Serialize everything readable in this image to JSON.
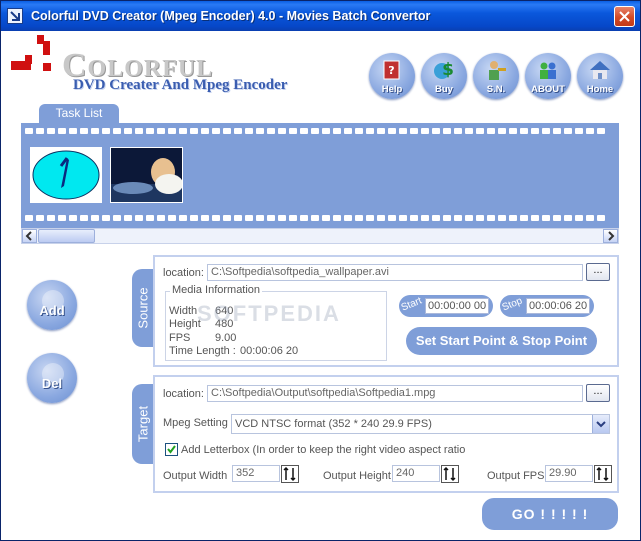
{
  "window": {
    "title": "Colorful DVD Creator (Mpeg Encoder) 4.0 - Movies Batch Convertor"
  },
  "logo": {
    "brand": "Colorful",
    "tagline": "DVD Creater And Mpeg Encoder"
  },
  "toolbar": [
    {
      "label": "Help",
      "icon": "help-book-icon"
    },
    {
      "label": "Buy",
      "icon": "dollar-globe-icon"
    },
    {
      "label": "S.N.",
      "icon": "person-key-icon"
    },
    {
      "label": "ABOUT",
      "icon": "people-icon"
    },
    {
      "label": "Home",
      "icon": "house-icon"
    }
  ],
  "tasklist": {
    "tab_label": "Task List"
  },
  "side": {
    "add_label": "Add",
    "del_label": "Del"
  },
  "source": {
    "tab_label": "Source",
    "location_label": "location:",
    "location_value": "C:\\Softpedia\\softpedia_wallpaper.avi",
    "browse_label": "...",
    "media_info": {
      "legend": "Media Information",
      "width_label": "Width",
      "width_value": "640",
      "height_label": "Height",
      "height_value": "480",
      "fps_label": "FPS",
      "fps_value": "9.00",
      "length_label": "Time Length :",
      "length_value": "00:00:06 20"
    },
    "start_label": "Start",
    "start_value": "00:00:00 00",
    "stop_label": "Stop",
    "stop_value": "00:00:06 20",
    "set_points_label": "Set Start Point & Stop Point"
  },
  "target": {
    "tab_label": "Target",
    "location_label": "location:",
    "location_value": "C:\\Softpedia\\Output\\softpedia\\Softpedia1.mpg",
    "browse_label": "...",
    "mpeg_label": "Mpeg Setting",
    "mpeg_value": "VCD NTSC format (352 * 240 29.9 FPS)",
    "letterbox_label": "Add Letterbox (In order to keep the right video aspect ratio",
    "letterbox_checked": true,
    "output_width_label": "Output Width",
    "output_width_value": "352",
    "output_height_label": "Output Height",
    "output_height_value": "240",
    "output_fps_label": "Output FPS",
    "output_fps_value": "29.90"
  },
  "go_label": "GO ! ! ! ! !",
  "watermark": "SOFTPEDIA",
  "colors": {
    "accent": "#7f9ed8",
    "titlebar": "#0a58dc",
    "panel_border": "#c3d0ee"
  }
}
